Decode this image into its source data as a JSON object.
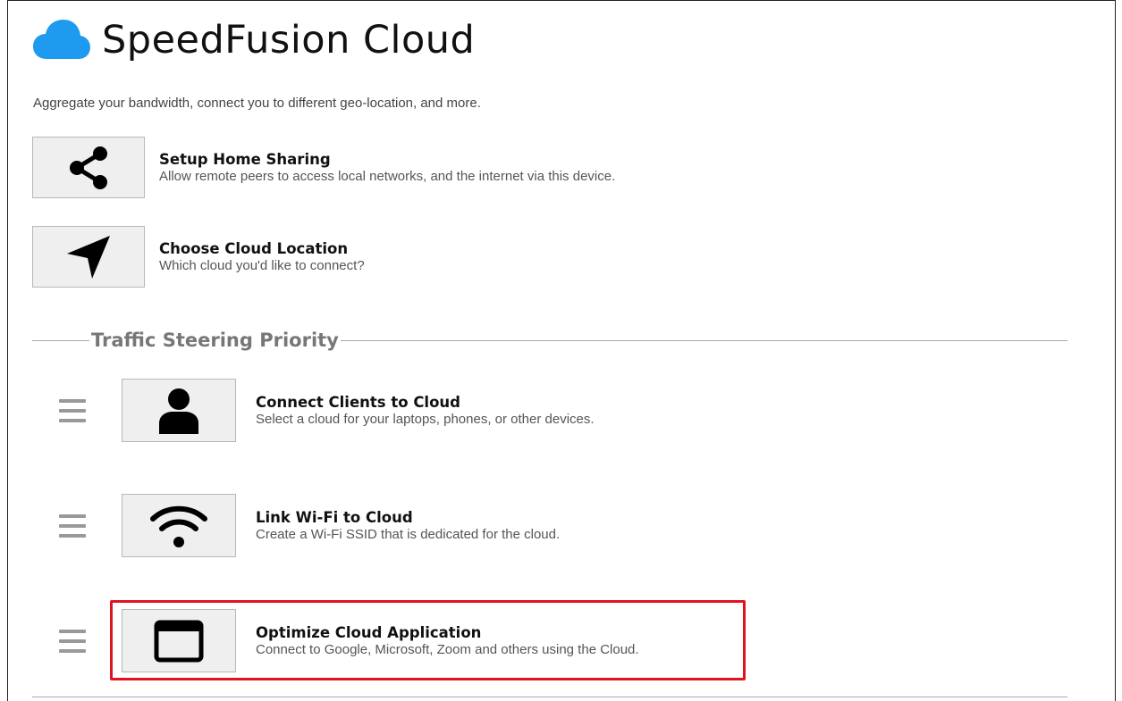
{
  "header": {
    "title": "SpeedFusion Cloud",
    "subtitle": "Aggregate your bandwidth, connect you to different geo-location, and more.",
    "logo_icon": "cloud-icon",
    "logo_color": "#1e9bef"
  },
  "top_items": [
    {
      "icon": "share-icon",
      "title": "Setup Home Sharing",
      "description": "Allow remote peers to access local networks, and the internet via this device."
    },
    {
      "icon": "location-arrow-icon",
      "title": "Choose Cloud Location",
      "description": "Which cloud you'd like to connect?"
    }
  ],
  "traffic_section": {
    "legend": "Traffic Steering Priority",
    "items": [
      {
        "icon": "user-icon",
        "title": "Connect Clients to Cloud",
        "description": "Select a cloud for your laptops, phones, or other devices."
      },
      {
        "icon": "wifi-icon",
        "title": "Link Wi-Fi to Cloud",
        "description": "Create a Wi-Fi SSID that is dedicated for the cloud."
      },
      {
        "icon": "window-icon",
        "title": "Optimize Cloud Application",
        "description": "Connect to Google, Microsoft, Zoom and others using the Cloud."
      }
    ]
  },
  "highlight_color": "#e0141f"
}
